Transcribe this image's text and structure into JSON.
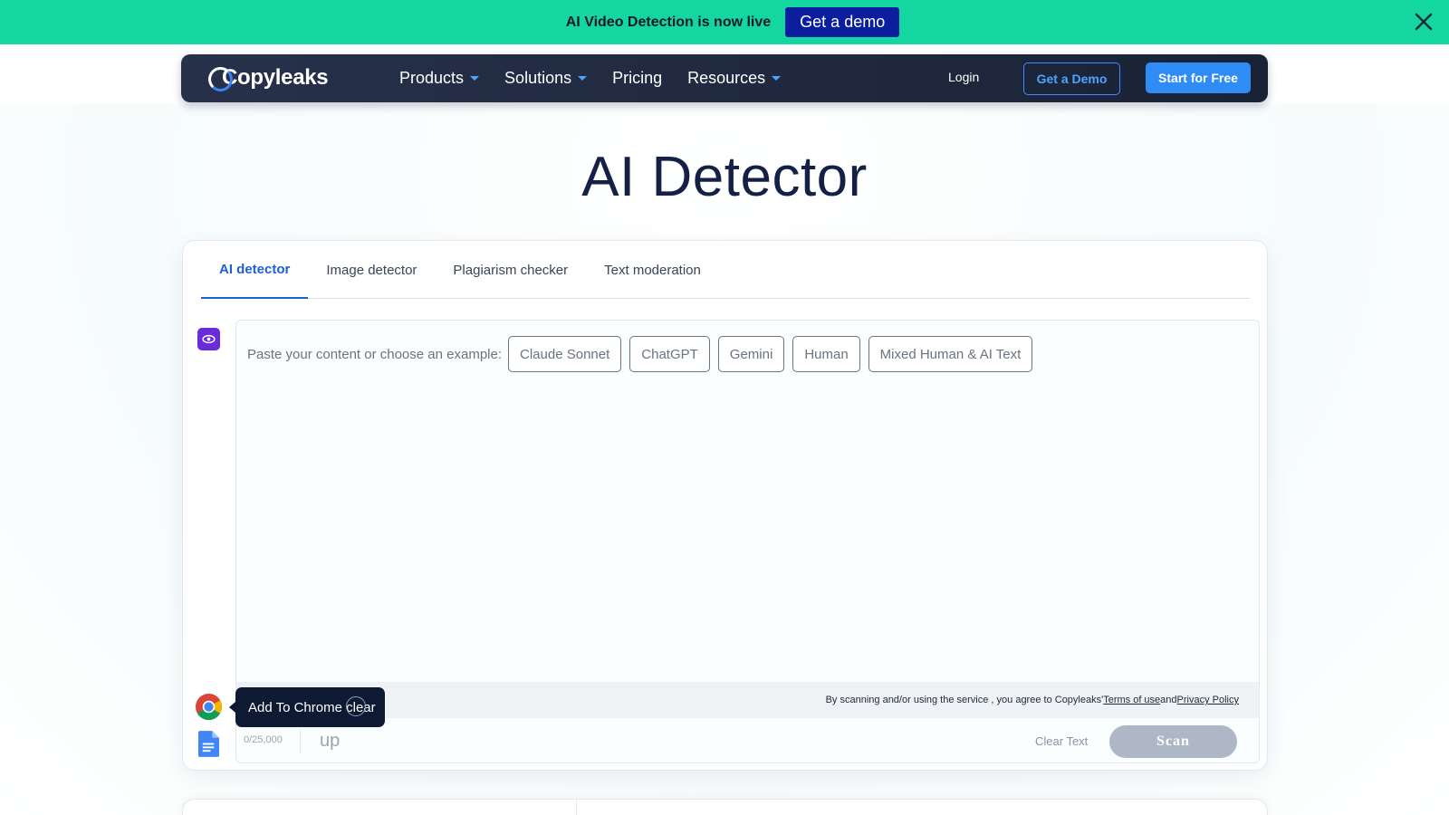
{
  "promo": {
    "text": "AI Video Detection is now live",
    "button": "Get a demo"
  },
  "nav": {
    "logo": "Copyleaks",
    "items": [
      {
        "label": "Products",
        "dropdown": true
      },
      {
        "label": "Solutions",
        "dropdown": true
      },
      {
        "label": "Pricing",
        "dropdown": false
      },
      {
        "label": "Resources",
        "dropdown": true
      }
    ],
    "login": "Login",
    "demo": "Get a Demo",
    "start": "Start for Free"
  },
  "page": {
    "title": "AI Detector"
  },
  "tabs": [
    {
      "label": "AI detector",
      "active": true
    },
    {
      "label": "Image detector",
      "active": false
    },
    {
      "label": "Plagiarism checker",
      "active": false
    },
    {
      "label": "Text moderation",
      "active": false
    }
  ],
  "editor": {
    "prompt": "Paste your content or choose an example:",
    "examples": [
      "Claude Sonnet",
      "ChatGPT",
      "Gemini",
      "Human",
      "Mixed Human & AI Text"
    ],
    "terms_prefix": "By scanning and/or using the service , you agree to Copyleaks' ",
    "terms_link": "Terms of use ",
    "terms_and": "and ",
    "privacy_link": "Privacy Policy",
    "count": "0/25,000",
    "upload_partial": "up",
    "clear": "Clear Text",
    "scan": "Scan"
  },
  "tooltip": {
    "text": "Add To Chrome clear"
  },
  "colors": {
    "promo_bg": "#14d6a0",
    "demo_button": "#0b1f9e",
    "accent": "#2f8cf5",
    "tab_active": "#1e5fd3",
    "eye_icon_bg": "#6a2bd8"
  }
}
